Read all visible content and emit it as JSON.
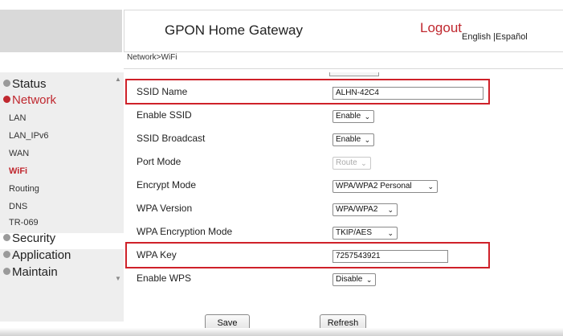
{
  "header": {
    "title": "GPON Home Gateway",
    "logout_label": "Logout",
    "lang_english": "English",
    "lang_sep": " |",
    "lang_spanish": "Español"
  },
  "breadcrumb": "Network>WiFi",
  "sidebar": {
    "status": "Status",
    "network": "Network",
    "sub_items": [
      "LAN",
      "LAN_IPv6",
      "WAN",
      "WiFi",
      "Routing",
      "DNS",
      "TR-069"
    ],
    "security": "Security",
    "application": "Application",
    "maintain": "Maintain",
    "scroll_up": "▲",
    "scroll_down": "▼"
  },
  "form": {
    "ssid_name": {
      "label": "SSID Name",
      "value": "ALHN-42C4"
    },
    "enable_ssid": {
      "label": "Enable SSID",
      "value": "Enable"
    },
    "ssid_broadcast": {
      "label": "SSID Broadcast",
      "value": "Enable"
    },
    "port_mode": {
      "label": "Port Mode",
      "value": "Route"
    },
    "encrypt_mode": {
      "label": "Encrypt Mode",
      "value": "WPA/WPA2 Personal"
    },
    "wpa_version": {
      "label": "WPA Version",
      "value": "WPA/WPA2"
    },
    "wpa_encryption_mode": {
      "label": "WPA Encryption Mode",
      "value": "TKIP/AES"
    },
    "wpa_key": {
      "label": "WPA Key",
      "value": "7257543921"
    },
    "enable_wps": {
      "label": "Enable WPS",
      "value": "Disable"
    }
  },
  "buttons": {
    "save": "Save",
    "refresh": "Refresh"
  },
  "icons": {
    "chevron": "⌄"
  },
  "colors": {
    "accent": "#c0282f",
    "highlight_box": "#cf2129",
    "sidebar_bg": "#eeeeee"
  }
}
